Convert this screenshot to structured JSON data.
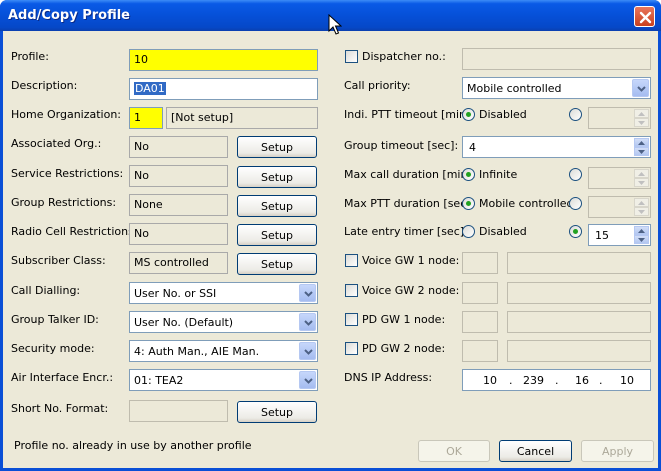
{
  "window": {
    "title": "Add/Copy Profile"
  },
  "left": {
    "profile": {
      "label": "Profile:",
      "value": "10"
    },
    "description": {
      "label": "Description:",
      "value": "DA01"
    },
    "home_org": {
      "label": "Home Organization:",
      "value": "1",
      "name": "[Not setup]"
    },
    "assoc_org": {
      "label": "Associated Org.:",
      "value": "No",
      "button": "Setup"
    },
    "service_restr": {
      "label": "Service Restrictions:",
      "value": "No",
      "button": "Setup"
    },
    "group_restr": {
      "label": "Group Restrictions:",
      "value": "None",
      "button": "Setup"
    },
    "radio_cell_restr": {
      "label": "Radio Cell Restrictions:",
      "value": "No",
      "button": "Setup"
    },
    "subscriber_class": {
      "label": "Subscriber Class:",
      "value": "MS controlled",
      "button": "Setup"
    },
    "call_dialling": {
      "label": "Call Dialling:",
      "value": "User No. or SSI"
    },
    "group_talker_id": {
      "label": "Group Talker ID:",
      "value": "User No. (Default)"
    },
    "security_mode": {
      "label": "Security mode:",
      "value": "4: Auth Man., AIE Man."
    },
    "air_interface": {
      "label": "Air Interface Encr.:",
      "value": "01: TEA2"
    },
    "short_no": {
      "label": "Short No. Format:",
      "value": "",
      "button": "Setup"
    }
  },
  "right": {
    "dispatcher": {
      "label": "Dispatcher no.:",
      "value": ""
    },
    "call_priority": {
      "label": "Call priority:",
      "value": "Mobile controlled"
    },
    "indi_ptt": {
      "label": "Indi. PTT timeout [min]:",
      "option": "Disabled",
      "value": ""
    },
    "group_timeout": {
      "label": "Group timeout [sec]:",
      "value": "4"
    },
    "max_call": {
      "label": "Max call duration [min]:",
      "option": "Infinite",
      "value": ""
    },
    "max_ptt": {
      "label": "Max PTT duration [sec]:",
      "option": "Mobile controlled",
      "value": ""
    },
    "late_entry": {
      "label": "Late entry timer [sec]:",
      "option": "Disabled",
      "value": "15"
    },
    "voice_gw1": {
      "label": "Voice GW 1 node:"
    },
    "voice_gw2": {
      "label": "Voice GW 2 node:"
    },
    "pd_gw1": {
      "label": "PD GW 1 node:"
    },
    "pd_gw2": {
      "label": "PD GW 2 node:"
    },
    "dns": {
      "label": "DNS IP Address:",
      "octets": [
        "10",
        "239",
        "16",
        "10"
      ],
      "sep": "."
    }
  },
  "footer": {
    "status": "Profile no. already in use by another profile",
    "ok": "OK",
    "cancel": "Cancel",
    "apply": "Apply"
  },
  "colors": {
    "titlebar": "#0a54dc",
    "client": "#ece9d8",
    "required": "#ffff00",
    "selection": "#316ac5"
  },
  "icons": {
    "close": "close-icon",
    "dropdown": "chevron-down-icon",
    "spin": "spinner-arrows-icon",
    "cursor": "mouse-pointer-icon"
  }
}
